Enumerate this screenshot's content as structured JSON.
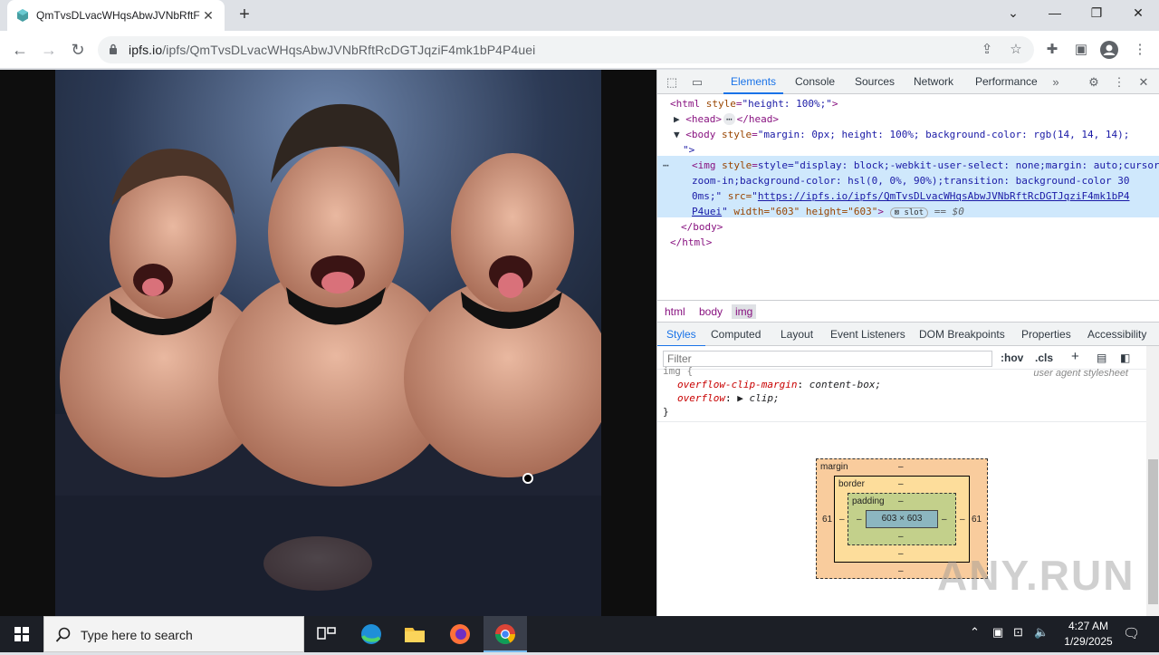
{
  "browser": {
    "tab_title": "QmTvsDLvacWHqsAbwJVNbRftF",
    "url_host": "ipfs.io",
    "url_path": "/ipfs/QmTvsDLvacWHqsAbwJVNbRftRcDGTJqziF4mk1bP4P4uei"
  },
  "devtools": {
    "tabs": [
      "Elements",
      "Console",
      "Sources",
      "Network",
      "Performance"
    ],
    "active_tab": "Elements",
    "dom": {
      "html_open_tag": "<html",
      "html_attr_name": "style",
      "html_attr_value": "\"height: 100%;\"",
      "html_close_bracket": ">",
      "head_text": "<head>",
      "head_close": "</head>",
      "body_tag": "<body",
      "body_attr_name": "style",
      "body_attr_value": "\"margin: 0px; height: 100%; background-color: rgb(14, 14, 14);",
      "body_attr_cont": "\">",
      "img_line1": "style=\"display: block;-webkit-user-select: none;margin: auto;cursor:",
      "img_line2": "zoom-in;background-color: hsl(0, 0%, 90%);transition: background-color 30",
      "img_line3a": "0ms;\"",
      "img_src_attr": "src=",
      "img_src_a": "https://ipfs.io/ipfs/QmTvsDLvacWHqsAbwJVNbRftRcDGTJqziF4mk1bP4",
      "img_src_b": "P4uei",
      "img_width": "width=\"603\"",
      "img_height": "height=\"603\"",
      "slot_badge": "slot",
      "eq_zero": "== $0",
      "body_close": "</body>",
      "html_close": "</html>"
    },
    "breadcrumbs": [
      "html",
      "body",
      "img"
    ],
    "subtabs": [
      "Styles",
      "Computed",
      "Layout",
      "Event Listeners",
      "DOM Breakpoints",
      "Properties",
      "Accessibility"
    ],
    "active_subtab": "Styles",
    "filter_placeholder": "Filter",
    "hov": ":hov",
    "cls": ".cls",
    "rule_selector": "img {",
    "ua_label": "user agent stylesheet",
    "rule1_prop": "overflow-clip-margin",
    "rule1_val": "content-box;",
    "rule2_prop": "overflow",
    "rule2_val": "clip;",
    "rule_close": "}",
    "boxmodel": {
      "margin_label": "margin",
      "border_label": "border",
      "padding_label": "padding",
      "content_size": "603 × 603",
      "dash": "–",
      "margin_left": "61",
      "margin_right": "61"
    }
  },
  "taskbar": {
    "search_placeholder": "Type here to search",
    "time": "4:27 AM",
    "date": "1/29/2025"
  },
  "watermark": "ANY.RUN",
  "colors": {
    "page_bg": "#0e0e0e",
    "accent": "#1a73e8"
  }
}
